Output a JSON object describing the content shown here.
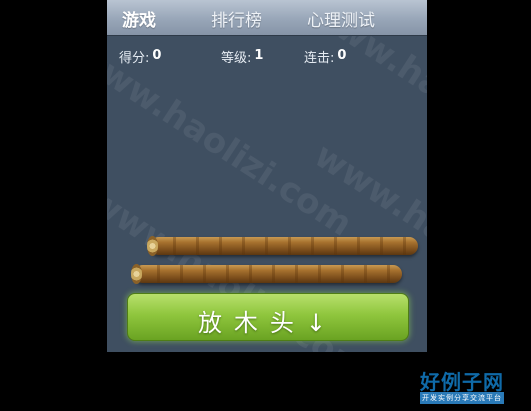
{
  "tabs": [
    {
      "label": "游戏",
      "active": true
    },
    {
      "label": "排行榜",
      "active": false
    },
    {
      "label": "心理测试",
      "active": false
    }
  ],
  "stats": {
    "score_label": "得分:",
    "score_value": "0",
    "level_label": "等级:",
    "level_value": "1",
    "combo_label": "连击:",
    "combo_value": "0"
  },
  "action_button": {
    "label": "放木头↓"
  },
  "watermark": "www.haolizi.com",
  "logo": {
    "title": "好例子网",
    "subtitle": "开发实例分享交流平台"
  },
  "colors": {
    "panel_bg": "#3f4f61",
    "header": "#98a6b8",
    "button": "#8fc63d",
    "logo": "#0f6aa8"
  }
}
